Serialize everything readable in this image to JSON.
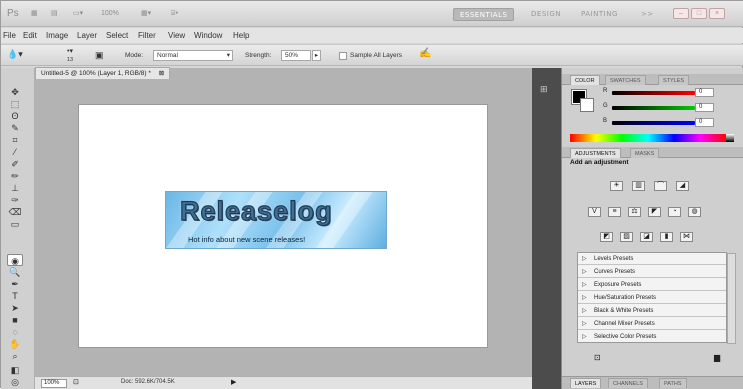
{
  "appbar": {
    "zoom": "100%",
    "workspaces": [
      "ESSENTIALS",
      "DESIGN",
      "PAINTING",
      ">>"
    ]
  },
  "menu": [
    "File",
    "Edit",
    "Image",
    "Layer",
    "Select",
    "Filter",
    "View",
    "Window",
    "Help"
  ],
  "options": {
    "brush_size": "13",
    "mode_label": "Mode:",
    "mode_value": "Normal",
    "strength_label": "Strength:",
    "strength_value": "50%",
    "sample_all_layers": "Sample All Layers"
  },
  "document": {
    "tab_title": "Untitled-5 @ 100% (Layer 1, RGB/8) *",
    "banner_title": "Releaselog",
    "banner_subtitle": "Hot info about new scene releases!"
  },
  "status": {
    "zoom": "100%",
    "doc_info": "Doc: 592.6K/704.5K"
  },
  "color_panel": {
    "tabs": [
      "COLOR",
      "SWATCHES",
      "STYLES"
    ],
    "channels": [
      {
        "label": "R",
        "value": "0",
        "color": "#e02020"
      },
      {
        "label": "G",
        "value": "0",
        "color": "#20b020"
      },
      {
        "label": "B",
        "value": "0",
        "color": "#2040e0"
      }
    ]
  },
  "adjustments_panel": {
    "tabs": [
      "ADJUSTMENTS",
      "MASKS"
    ],
    "heading": "Add an adjustment",
    "presets": [
      "Levels Presets",
      "Curves Presets",
      "Exposure Presets",
      "Hue/Saturation Presets",
      "Black & White Presets",
      "Channel Mixer Presets",
      "Selective Color Presets"
    ]
  },
  "layers_panel": {
    "tabs": [
      "LAYERS",
      "CHANNELS",
      "PATHS"
    ]
  }
}
